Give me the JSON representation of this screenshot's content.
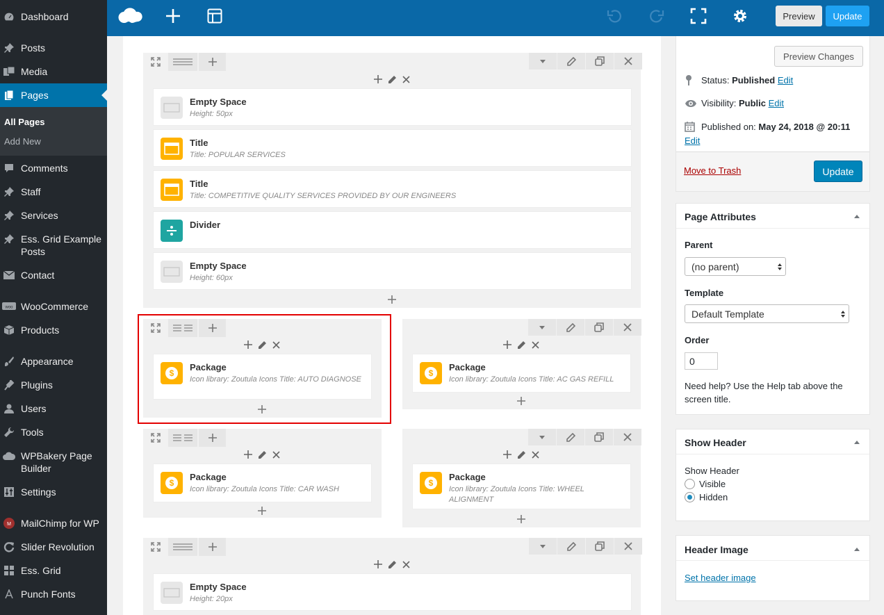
{
  "sidebar": {
    "items": [
      {
        "id": "dashboard",
        "label": "Dashboard",
        "icon": "dashboard-icon"
      },
      {
        "id": "posts",
        "label": "Posts",
        "icon": "pin-icon"
      },
      {
        "id": "media",
        "label": "Media",
        "icon": "media-icon"
      },
      {
        "id": "pages",
        "label": "Pages",
        "icon": "pages-icon"
      },
      {
        "id": "comments",
        "label": "Comments",
        "icon": "comment-icon"
      },
      {
        "id": "staff",
        "label": "Staff",
        "icon": "pin-icon"
      },
      {
        "id": "services",
        "label": "Services",
        "icon": "pin-icon"
      },
      {
        "id": "essgridposts",
        "label": "Ess. Grid Example Posts",
        "icon": "pin-icon"
      },
      {
        "id": "contact",
        "label": "Contact",
        "icon": "mail-icon"
      },
      {
        "id": "woocommerce",
        "label": "WooCommerce",
        "icon": "woo-icon"
      },
      {
        "id": "products",
        "label": "Products",
        "icon": "box-icon"
      },
      {
        "id": "appearance",
        "label": "Appearance",
        "icon": "brush-icon"
      },
      {
        "id": "plugins",
        "label": "Plugins",
        "icon": "plug-icon"
      },
      {
        "id": "users",
        "label": "Users",
        "icon": "user-icon"
      },
      {
        "id": "tools",
        "label": "Tools",
        "icon": "wrench-icon"
      },
      {
        "id": "wpbakery",
        "label": "WPBakery Page Builder",
        "icon": "cloud-icon"
      },
      {
        "id": "settings",
        "label": "Settings",
        "icon": "settings-icon"
      },
      {
        "id": "mailchimp",
        "label": "MailChimp for WP",
        "icon": "mailchimp-icon"
      },
      {
        "id": "sliderrev",
        "label": "Slider Revolution",
        "icon": "refresh-icon"
      },
      {
        "id": "essgrid",
        "label": "Ess. Grid",
        "icon": "grid-icon"
      },
      {
        "id": "punchfonts",
        "label": "Punch Fonts",
        "icon": "font-icon"
      }
    ],
    "submenu": {
      "all_pages": "All Pages",
      "add_new": "Add New"
    }
  },
  "toolbar": {
    "preview_label": "Preview",
    "update_label": "Update",
    "icons": [
      "wpbakery-logo-icon",
      "add-element-icon",
      "templates-icon",
      "undo-icon",
      "redo-icon",
      "fullscreen-icon",
      "settings-gear-icon"
    ]
  },
  "editor": {
    "row1": {
      "elements": [
        {
          "title": "Empty Space",
          "desc": "Height: 50px",
          "icon": "empty-space-icon"
        },
        {
          "title": "Title",
          "desc": "Title: POPULAR SERVICES",
          "icon": "title-icon"
        },
        {
          "title": "Title",
          "desc": "Title: COMPETITIVE QUALITY SERVICES PROVIDED BY OUR ENGINEERS",
          "icon": "title-icon"
        },
        {
          "title": "Divider",
          "desc": "",
          "icon": "divider-icon"
        },
        {
          "title": "Empty Space",
          "desc": "Height: 60px",
          "icon": "empty-space-icon"
        }
      ]
    },
    "row2": {
      "left": {
        "title": "Package",
        "desc": "Icon library: Zoutula Icons  Title: AUTO DIAGNOSE"
      },
      "right": {
        "title": "Package",
        "desc": "Icon library: Zoutula Icons  Title: AC GAS REFILL"
      }
    },
    "row3": {
      "left": {
        "title": "Package",
        "desc": "Icon library: Zoutula Icons  Title: CAR WASH"
      },
      "right": {
        "title": "Package",
        "desc": "Icon library: Zoutula Icons  Title: WHEEL ALIGNMENT"
      }
    },
    "row4": {
      "elements": [
        {
          "title": "Empty Space",
          "desc": "Height: 20px",
          "icon": "empty-space-icon"
        }
      ]
    }
  },
  "publish": {
    "preview_changes": "Preview Changes",
    "status_label": "Status:",
    "status_value": "Published",
    "visibility_label": "Visibility:",
    "visibility_value": "Public",
    "published_label": "Published on:",
    "published_value": "May 24, 2018 @ 20:11",
    "edit": "Edit",
    "trash": "Move to Trash",
    "update": "Update"
  },
  "page_attributes": {
    "title": "Page Attributes",
    "parent_label": "Parent",
    "parent_value": "(no parent)",
    "template_label": "Template",
    "template_value": "Default Template",
    "order_label": "Order",
    "order_value": "0",
    "help": "Need help? Use the Help tab above the screen title."
  },
  "show_header": {
    "title": "Show Header",
    "label": "Show Header",
    "option_visible": "Visible",
    "option_hidden": "Hidden",
    "selected": "Hidden"
  },
  "header_image": {
    "title": "Header Image",
    "link": "Set header image"
  },
  "colors": {
    "sidebar_bg": "#23282d",
    "active_blue": "#0073aa",
    "toolbar_blue": "#0a68a7",
    "title_orange": "#ffb200",
    "divider_teal": "#1fa5a1",
    "highlight_red": "#e30000"
  }
}
